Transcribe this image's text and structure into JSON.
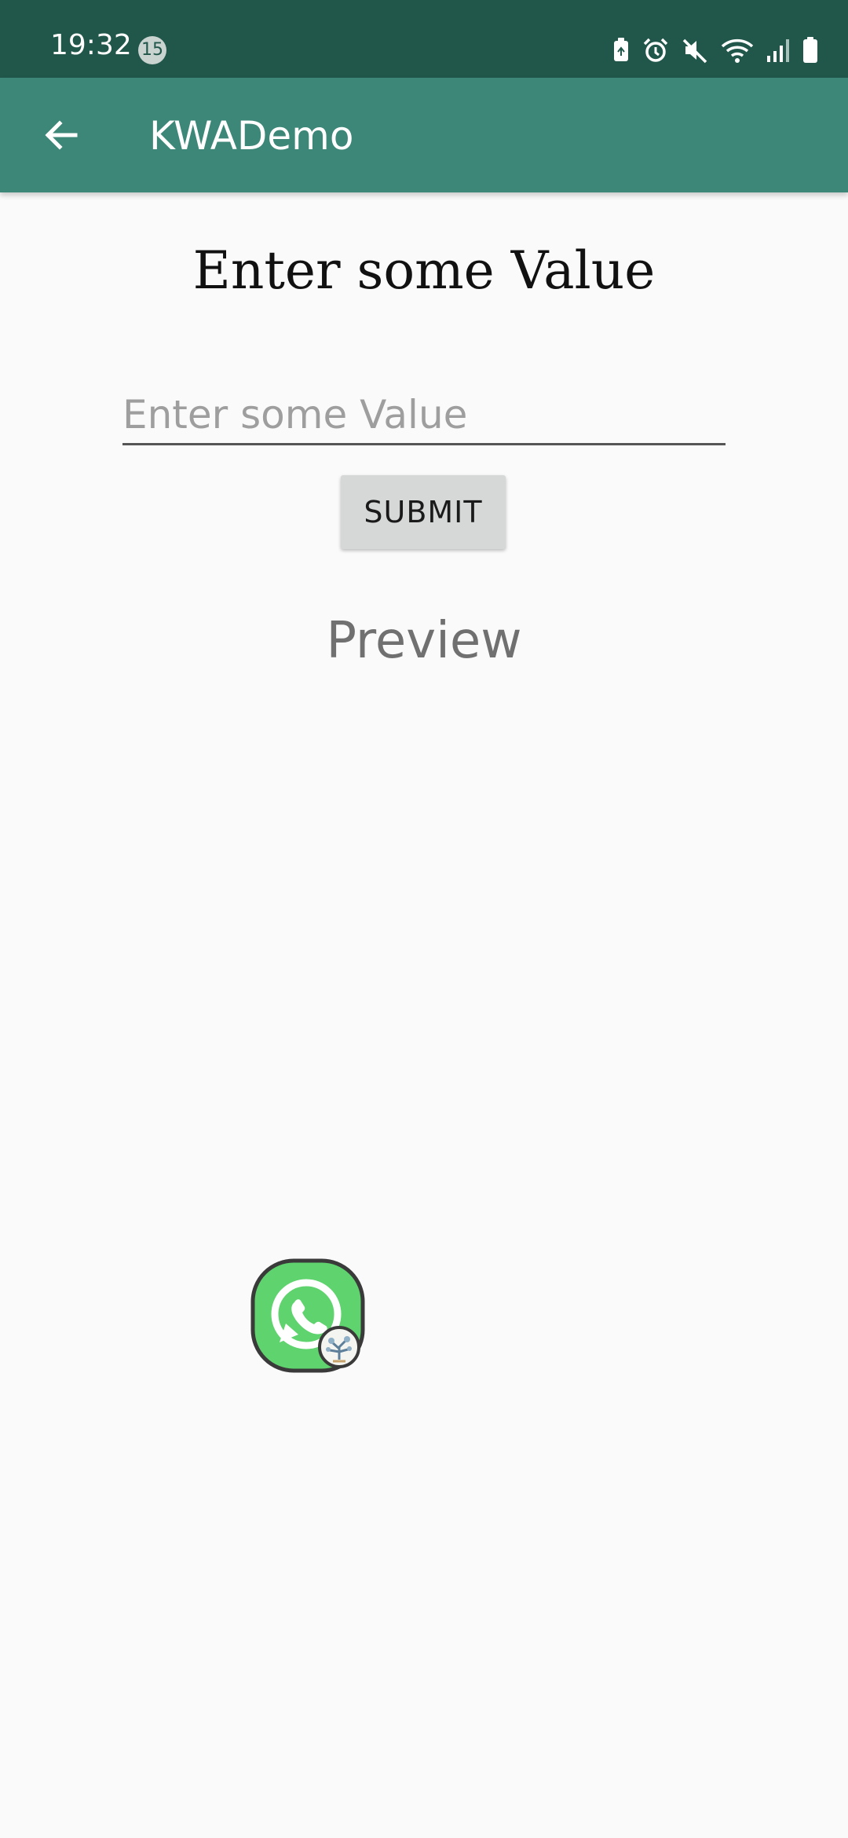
{
  "status_bar": {
    "time": "19:32",
    "notification_count": "15",
    "icons": [
      "battery-saver-icon",
      "alarm-icon",
      "mute-icon",
      "wifi-icon",
      "signal-icon",
      "battery-icon"
    ]
  },
  "app_bar": {
    "title": "KWADemo",
    "back_icon": "arrow-back-icon",
    "color": "#3c8778",
    "status_color": "#21574b"
  },
  "main": {
    "heading": "Enter some Value",
    "input": {
      "placeholder": "Enter some Value",
      "value": ""
    },
    "submit_label": "SUBMIT",
    "preview_label": "Preview"
  },
  "floating_icon": {
    "name": "whatsapp-icon",
    "badge": "profile-badge-icon"
  }
}
